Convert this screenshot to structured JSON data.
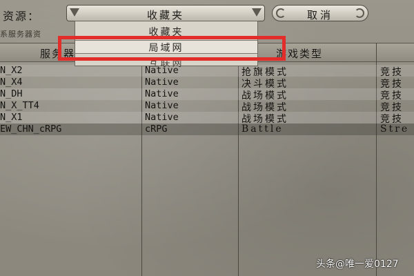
{
  "source": {
    "label": "资源：",
    "selected": "收藏夹"
  },
  "cancel_label": "取消",
  "server_resource_label": "系服务器资",
  "table": {
    "headers": [
      "服务器",
      "游戏类型"
    ],
    "rows": [
      [
        "N_X2",
        "Native",
        "抢旗模式",
        "竞技"
      ],
      [
        "N_X4",
        "Native",
        "决斗模式",
        "竞技"
      ],
      [
        "N_DH",
        "Native",
        "战场模式",
        "竞技"
      ],
      [
        "N_X_TT4",
        "Native",
        "战场模式",
        "竞技"
      ],
      [
        "N_X1",
        "Native",
        "战场模式",
        "竞技"
      ],
      [
        "EW_CHN_cRPG",
        "cRPG",
        "Battle",
        "Stre"
      ]
    ]
  },
  "dropdown": {
    "options": [
      "收藏夹",
      "局域网",
      "互联网"
    ],
    "highlighted": "局域网"
  },
  "watermark": "头条@唯一爱0127",
  "colors": {
    "highlight": "#e32d2b"
  }
}
